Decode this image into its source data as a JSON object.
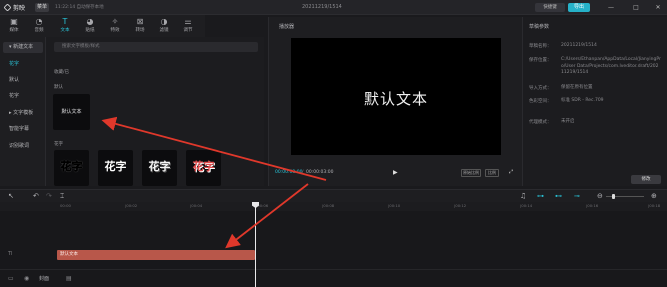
{
  "titlebar": {
    "logo_text": "剪映",
    "menu_label": "菜单",
    "autosave": "11:22:14 自动保存本地",
    "project_title": "20211219/1514",
    "shortcut_label": "快捷键",
    "export_label": "导出",
    "minimize": "—",
    "maximize": "□",
    "close": "✕"
  },
  "toolbar": {
    "items": [
      {
        "label": "媒体",
        "icon": "media-icon"
      },
      {
        "label": "音频",
        "icon": "audio-icon"
      },
      {
        "label": "文本",
        "icon": "text-icon"
      },
      {
        "label": "贴纸",
        "icon": "sticker-icon"
      },
      {
        "label": "特效",
        "icon": "effects-icon"
      },
      {
        "label": "转场",
        "icon": "transition-icon"
      },
      {
        "label": "滤镜",
        "icon": "filter-icon"
      },
      {
        "label": "调节",
        "icon": "adjust-icon"
      }
    ]
  },
  "leftnav": {
    "items": [
      "▾ 新建文本",
      "花字",
      "默认",
      "花字",
      "▸ 文字模板",
      "智能字幕",
      "识别歌词"
    ]
  },
  "textpanel": {
    "search_placeholder": "搜索文字模板/样式",
    "section_favorites": "收藏/已",
    "section_default": "默认",
    "default_card_text": "默认文本",
    "section_fx": "花字",
    "fx_cards": [
      "花字",
      "花字",
      "花字",
      "花字"
    ]
  },
  "player": {
    "title": "播放器",
    "screen_text": "默认文本",
    "timecode_current": "00:00:03:00",
    "timecode_total": "00:00:03:00",
    "play_icon": "play-icon",
    "btn_original": "原始比例",
    "btn_ratio": "比例"
  },
  "params": {
    "title": "草稿参数",
    "rows": [
      {
        "label": "草稿名称：",
        "value": "20211219/1514"
      },
      {
        "label": "保存位置：",
        "value": "C:/Users/Ethanpan/AppData/Local/JianyingPro/User Data/Projects/com.lveditor.draft/20211219/1514"
      },
      {
        "label": "导入方式：",
        "value": "保留在原有位置"
      },
      {
        "label": "色彩空间：",
        "value": "标准 SDR - Rec.709"
      },
      {
        "label": "代理模式：",
        "value": "未开启"
      }
    ],
    "modify_label": "修改"
  },
  "timeline": {
    "ticks": [
      "00:00",
      "|00:02",
      "|00:04",
      "|00:06",
      "|00:08",
      "|00:10",
      "|00:12",
      "|00:14",
      "|00:16",
      "|00:18"
    ],
    "clip_label": "默认文本",
    "track_label": "TI",
    "cover_label": "封面"
  },
  "colors": {
    "accent": "#29c4d8",
    "clip": "#b8574a",
    "annotation_arrow": "#e0382b"
  }
}
